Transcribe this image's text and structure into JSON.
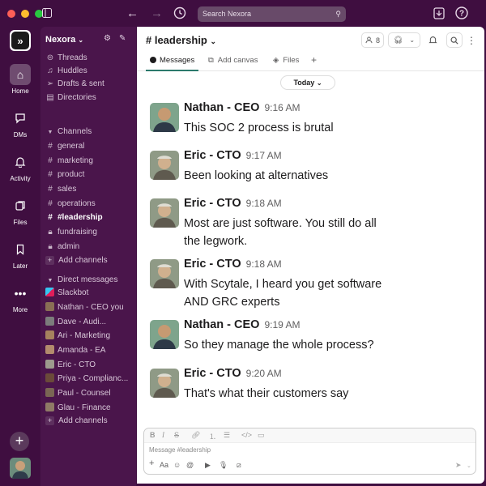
{
  "titlebar": {
    "search_placeholder": "Search Nexora"
  },
  "rail": {
    "items": [
      {
        "label": "Home",
        "icon": "home-icon"
      },
      {
        "label": "DMs",
        "icon": "dms-icon"
      },
      {
        "label": "Activity",
        "icon": "bell-icon"
      },
      {
        "label": "Files",
        "icon": "files-icon"
      },
      {
        "label": "Later",
        "icon": "bookmark-icon"
      },
      {
        "label": "More",
        "icon": "more-icon"
      }
    ]
  },
  "sidebar": {
    "workspace": "Nexora",
    "nav": [
      "Threads",
      "Huddles",
      "Drafts & sent",
      "Directories"
    ],
    "channels_header": "Channels",
    "channels": [
      "general",
      "marketing",
      "product",
      "sales",
      "operations",
      "#leadership",
      "fundraising",
      "admin"
    ],
    "add_channels": "Add channels",
    "dm_header": "Direct messages",
    "dms": [
      "Slackbot",
      "Nathan - CEO  you",
      "Dave - Audi...",
      "Ari - Marketing",
      "Amanda - EA",
      "Eric - CTO",
      "Priya - Complianc...",
      "Paul - Counsel",
      "Glau - Finance"
    ],
    "add_channels_2": "Add channels"
  },
  "header": {
    "channel": "# leadership",
    "member_count": "8"
  },
  "tabs": [
    "Messages",
    "Add canvas",
    "Files"
  ],
  "day_divider": "Today",
  "messages": [
    {
      "author": "Nathan - CEO",
      "time": "9:16 AM",
      "text": "This SOC 2 process is brutal"
    },
    {
      "author": "Eric - CTO",
      "time": "9:17 AM",
      "text": "Been looking at alternatives"
    },
    {
      "author": "Eric - CTO",
      "time": "9:18 AM",
      "text": "Most are just software. You still do all the legwork."
    },
    {
      "author": "Eric - CTO",
      "time": "9:18 AM",
      "text": "With Scytale, I heard you get software AND GRC experts"
    },
    {
      "author": "Nathan - CEO",
      "time": "9:19 AM",
      "text": "So they manage the whole process?"
    },
    {
      "author": "Eric - CTO",
      "time": "9:20 AM",
      "text": "That's what their customers say"
    }
  ],
  "composer": {
    "placeholder": "Message #leadership"
  },
  "colors": {
    "aubergine": "#3f0e40",
    "sidebar": "#4a154b",
    "accent": "#2b7a6c"
  }
}
